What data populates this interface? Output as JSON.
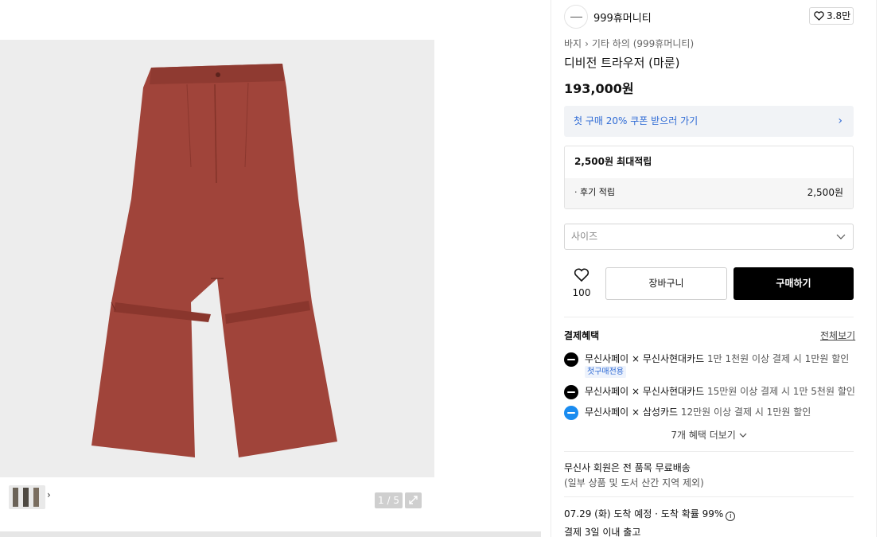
{
  "brand": {
    "name": "999휴머니티",
    "likes": "3.8만"
  },
  "breadcrumb": {
    "category": "바지",
    "separator": "›",
    "sub": "기타 하의 (999휴머니티)"
  },
  "product": {
    "title": "디비전 트라우저 (마룬)",
    "price": "193,000원"
  },
  "coupon": {
    "label": "첫 구매 20% 쿠폰 받으러 가기"
  },
  "points": {
    "header": "2,500원 최대적립",
    "review_label": "· 후기 적립",
    "review_value": "2,500원"
  },
  "size": {
    "placeholder": "사이즈"
  },
  "actions": {
    "wish_count": "100",
    "cart": "장바구니",
    "buy": "구매하기"
  },
  "benefits": {
    "title": "결제혜택",
    "see_all": "전체보기",
    "items": [
      {
        "name": "무신사페이 × 무신사현대카드",
        "condition": "1만 1천원 이상 결제 시 1만원 할인",
        "badge": "첫구매전용"
      },
      {
        "name": "무신사페이 × 무신사현대카드",
        "condition": "15만원 이상 결제 시 1만 5천원 할인"
      },
      {
        "name": "무신사페이 × 삼성카드",
        "condition": "12만원 이상 결제 시 1만원 할인"
      }
    ],
    "more": "7개 혜택 더보기"
  },
  "shipping": {
    "free": "무신사 회원은 전 품목 무료배송",
    "exception": "(일부 상품 및 도서 산간 지역 제외)",
    "arrival": "07.29 (화) 도착 예정 · 도착 확률 99%",
    "release": "결제 3일 이내 출고"
  },
  "gallery": {
    "counter": "1 / 5",
    "product_color": "#a0443a"
  }
}
